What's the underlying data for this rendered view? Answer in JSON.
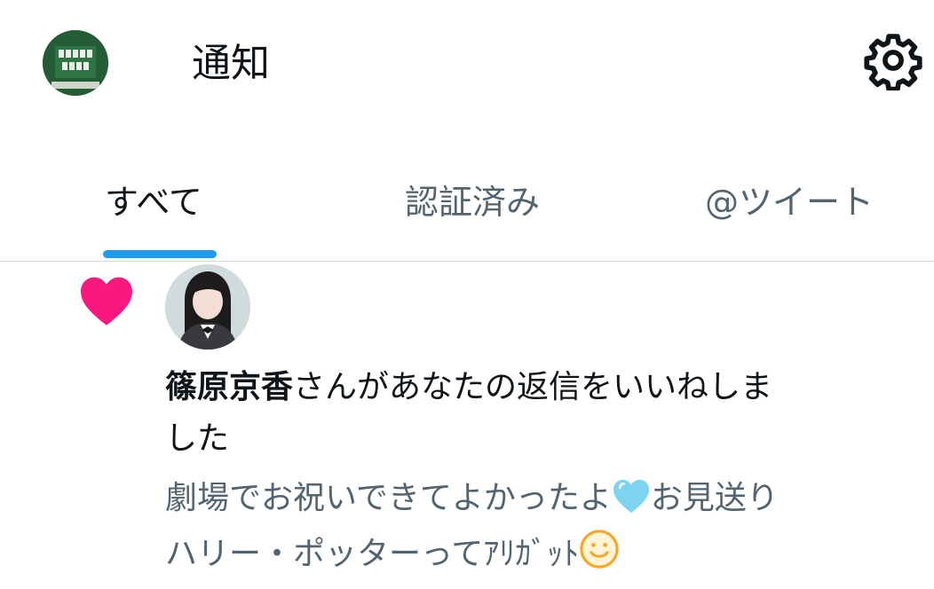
{
  "header": {
    "title": "通知",
    "settings_icon": "gear-icon"
  },
  "tabs": [
    {
      "label": "すべて",
      "active": true
    },
    {
      "label": "認証済み",
      "active": false
    },
    {
      "label": "@ツイート",
      "active": false
    }
  ],
  "colors": {
    "accent": "#1d9bf0",
    "like_heart": "#f91880",
    "secondary_text": "#536471",
    "emoji_heart": "#7dd3f0",
    "emoji_smile": "#f6a623"
  },
  "notification": {
    "type_icon": "heart-icon",
    "user_name": "篠原京香",
    "action_line1": "さんがあなたの返信をいいねしま",
    "action_line2": "した",
    "quote_line1_a": "劇場でお祝いできてよかったよ",
    "quote_line1_b": "お見送り",
    "quote_line2": "ハリー・ポッターってｱﾘｶﾞｯﾄ"
  }
}
